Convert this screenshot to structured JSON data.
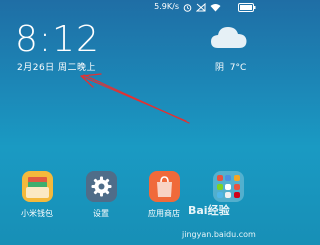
{
  "status_bar": {
    "network_speed": "5.9K/s",
    "icons": [
      "alarm-icon",
      "no-sim-icon",
      "wifi-icon",
      "battery-icon"
    ]
  },
  "lock_screen": {
    "time": "8:12",
    "date": "2月26日 周二晚上"
  },
  "weather": {
    "icon": "cloud-icon",
    "condition": "阴",
    "temperature": "7°C"
  },
  "annotation": {
    "color": "#e53030"
  },
  "dock": {
    "apps": [
      {
        "label": "小米钱包",
        "icon": "wallet-icon"
      },
      {
        "label": "设置",
        "icon": "settings-gear-icon"
      },
      {
        "label": "应用商店",
        "icon": "app-store-bag-icon"
      },
      {
        "label": "",
        "icon": "app-folder-icon"
      }
    ]
  },
  "watermark": {
    "brand": "Bai经验",
    "url": "jingyan.baidu.com"
  }
}
